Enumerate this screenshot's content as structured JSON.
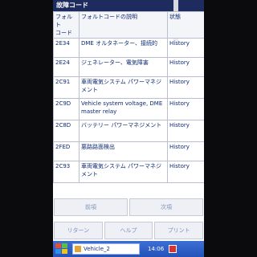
{
  "window": {
    "title": "故障コード"
  },
  "table": {
    "headers": [
      "フォルト\nコード",
      "フォルトコードの説明",
      "状態"
    ],
    "rows": [
      [
        "2E34",
        "DME オルタネーター、接続的",
        "History"
      ],
      [
        "2E24",
        "ジェネレーター、電気障害",
        "History"
      ],
      [
        "2C91",
        "車両電気システム パワーマネジメント",
        "History"
      ],
      [
        "2C9D",
        "Vehicle system voltage, DME master relay",
        "History"
      ],
      [
        "2C8D",
        "バッテリー パワーマネジメント",
        "History"
      ],
      [
        "2FED",
        "悪路路面検出",
        "History"
      ],
      [
        "2C93",
        "車両電気システム パワーマネジメント",
        "History"
      ]
    ]
  },
  "buttons": {
    "prev": "前項",
    "next": "次項",
    "return": "リターン",
    "help": "ヘルプ",
    "print": "プリント"
  },
  "taskbar": {
    "app_label": "Vehicle_2",
    "clock": "14:06"
  },
  "colors": {
    "title_bg": "#1e2b5e",
    "text": "#0d2a74",
    "taskbar": "#2453b8"
  }
}
